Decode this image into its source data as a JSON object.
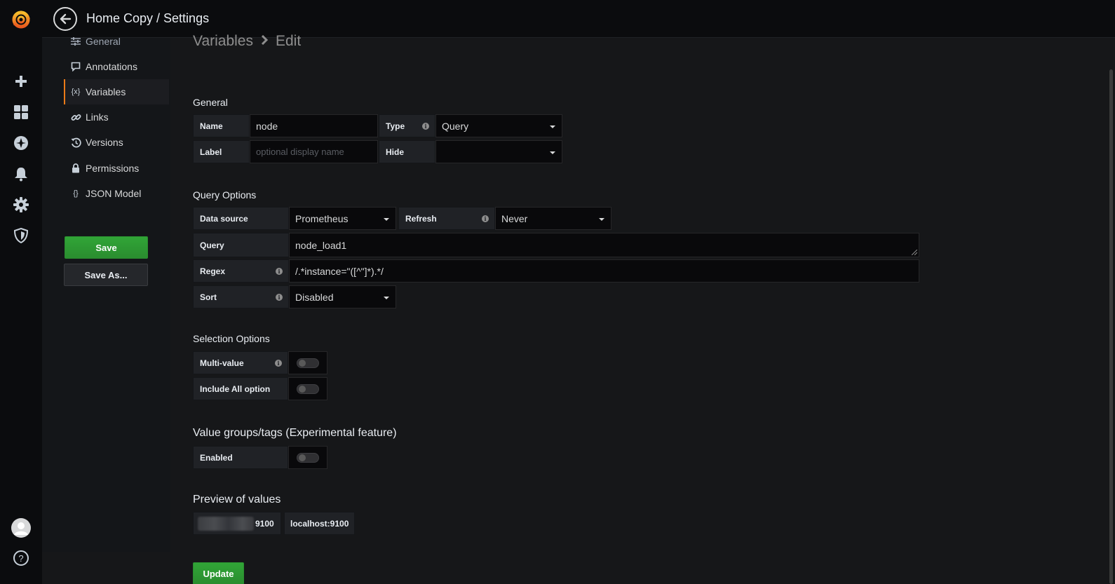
{
  "header": {
    "title": "Home Copy / Settings"
  },
  "rail": {
    "icons": [
      "grafana-logo-icon",
      "plus-icon",
      "dashboards-icon",
      "explore-icon",
      "alerting-bell-icon",
      "gear-icon",
      "shield-icon",
      "avatar",
      "help-icon"
    ]
  },
  "sidebar": {
    "items": [
      {
        "label": "General",
        "icon": "sliders-icon"
      },
      {
        "label": "Annotations",
        "icon": "comment-icon"
      },
      {
        "label": "Variables",
        "icon": "variable-icon",
        "icon_text": "{x}",
        "active": true
      },
      {
        "label": "Links",
        "icon": "link-icon"
      },
      {
        "label": "Versions",
        "icon": "history-icon"
      },
      {
        "label": "Permissions",
        "icon": "lock-icon"
      },
      {
        "label": "JSON Model",
        "icon": "json-icon",
        "icon_text": "{}"
      }
    ],
    "save_label": "Save",
    "save_as_label": "Save As..."
  },
  "breadcrumb": {
    "parent": "Variables",
    "current": "Edit"
  },
  "general": {
    "title": "General",
    "name_label": "Name",
    "name_value": "node",
    "type_label": "Type",
    "type_value": "Query",
    "label_label": "Label",
    "label_placeholder": "optional display name",
    "hide_label": "Hide",
    "hide_value": ""
  },
  "query_options": {
    "title": "Query Options",
    "datasource_label": "Data source",
    "datasource_value": "Prometheus",
    "refresh_label": "Refresh",
    "refresh_value": "Never",
    "query_label": "Query",
    "query_value": "node_load1",
    "regex_label": "Regex",
    "regex_value": "/.*instance=\"([^\"]*).*/",
    "sort_label": "Sort",
    "sort_value": "Disabled"
  },
  "selection_options": {
    "title": "Selection Options",
    "multi_label": "Multi-value",
    "multi_on": false,
    "include_all_label": "Include All option",
    "include_all_on": false
  },
  "value_groups": {
    "title": "Value groups/tags (Experimental feature)",
    "enabled_label": "Enabled",
    "enabled_on": false
  },
  "preview": {
    "title": "Preview of values",
    "values": [
      "9100",
      "localhost:9100"
    ]
  },
  "update_label": "Update",
  "colors": {
    "accent": "#eb7b18",
    "primary_button": "#299c30",
    "background": "#161719"
  }
}
